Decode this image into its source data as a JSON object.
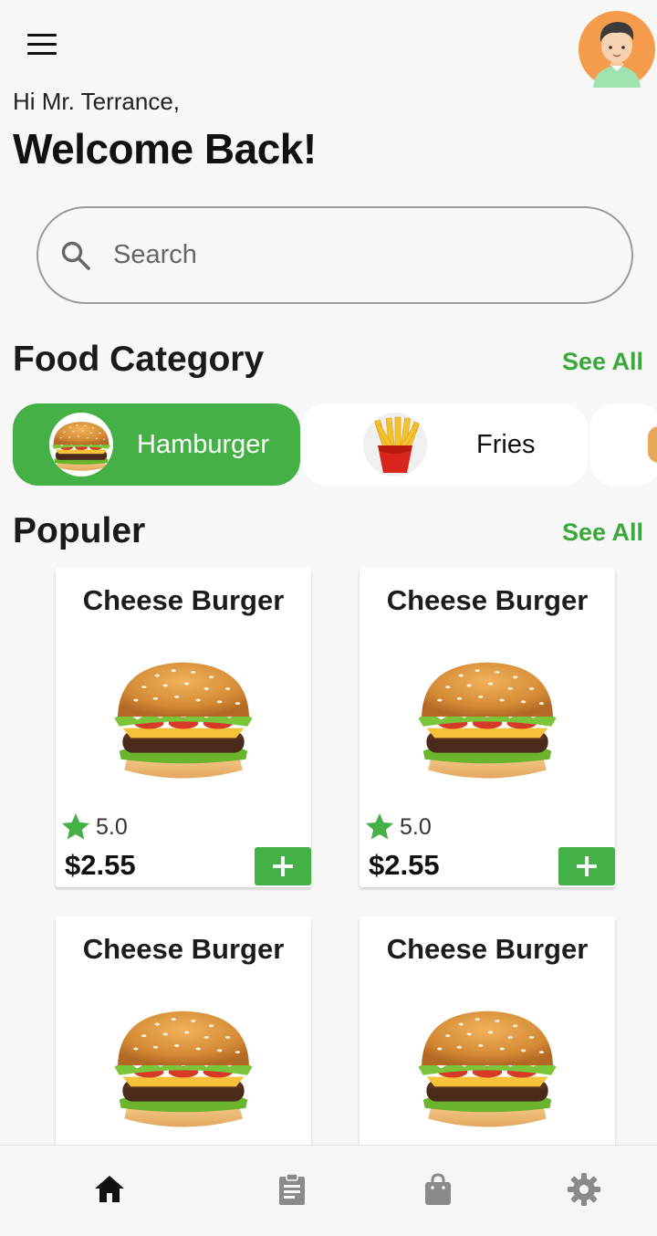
{
  "header": {
    "menu_icon": "hamburger-menu-icon",
    "avatar_icon": "user-avatar",
    "greeting": "Hi Mr. Terrance,",
    "welcome": "Welcome Back!"
  },
  "search": {
    "placeholder": "Search",
    "icon": "search-icon"
  },
  "categories": {
    "title": "Food Category",
    "see_all": "See All",
    "items": [
      {
        "label": "Hamburger",
        "active": true
      },
      {
        "label": "Fries",
        "active": false
      }
    ]
  },
  "popular": {
    "title": "Populer",
    "see_all": "See All",
    "items": [
      {
        "name": "Cheese Burger",
        "rating": "5.0",
        "price": "$2.55"
      },
      {
        "name": "Cheese Burger",
        "rating": "5.0",
        "price": "$2.55"
      },
      {
        "name": "Cheese Burger"
      },
      {
        "name": "Cheese Burger"
      }
    ]
  },
  "bottom_nav": [
    {
      "icon": "home-icon",
      "active": true
    },
    {
      "icon": "clipboard-icon",
      "active": false
    },
    {
      "icon": "shopping-bag-icon",
      "active": false
    },
    {
      "icon": "settings-gear-icon",
      "active": false
    }
  ],
  "colors": {
    "accent": "#45b045",
    "background": "#f7f7f7",
    "card": "#ffffff",
    "nav_inactive": "#8a8a8a"
  }
}
